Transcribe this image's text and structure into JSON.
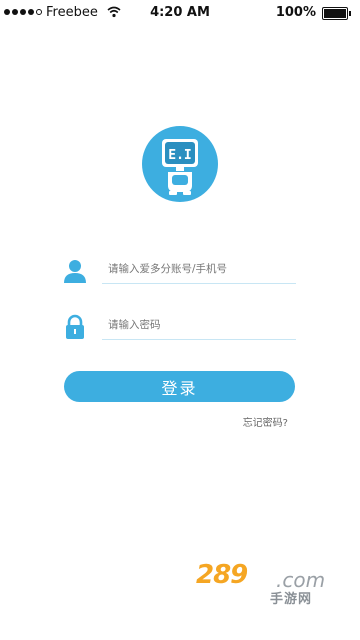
{
  "status_bar": {
    "carrier": "Freebee",
    "time": "4:20 AM",
    "battery": "100%"
  },
  "logo": {
    "icon": "robot-icon",
    "text": "E.I"
  },
  "login_form": {
    "account_placeholder": "请输入爱多分账号/手机号",
    "password_placeholder": "请输入密码",
    "submit_label": "登录",
    "forgot_password": "忘记密码?"
  },
  "watermark": {
    "number": "289",
    "domain": ".com",
    "text": "手游网"
  },
  "colors": {
    "accent": "#3daee0",
    "input_underline": "#c8e6f4",
    "watermark_orange": "#f5a623"
  }
}
